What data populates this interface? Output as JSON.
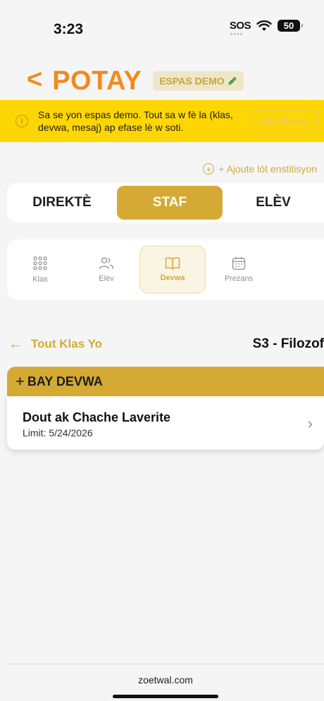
{
  "status_bar": {
    "time": "3:23",
    "sos": "SOS",
    "battery": "50"
  },
  "header": {
    "back_label": "<",
    "brand": "POTAY",
    "demo_badge": "ESPAS DEMO"
  },
  "banner": {
    "message": "Sa se yon espas demo. Tout sa w fè la (klas, devwa, mesaj) ap efase lè w soti.",
    "exit_label": "Kite Demo"
  },
  "add_institution": "+ Ajoute lòt enstitisyon",
  "role_tabs": [
    {
      "label": "DIREKTÈ"
    },
    {
      "label": "STAF",
      "active": true
    },
    {
      "label": "ELÈV"
    }
  ],
  "features": [
    {
      "label": "Klas",
      "icon": "grid-icon"
    },
    {
      "label": "Elèv",
      "icon": "users-icon"
    },
    {
      "label": "Devwa",
      "icon": "book-icon",
      "active": true
    },
    {
      "label": "Prezans",
      "icon": "calendar-icon"
    }
  ],
  "breadcrumb": {
    "back_label": "Tout Klas Yo",
    "class_title": "S3 - Filozof"
  },
  "assign_button": "BAY DEVWA",
  "assignment": {
    "title": "Dout ak Chache Laverite",
    "due": "Limit: 5/24/2026"
  },
  "footer": {
    "url": "zoetwal.com"
  },
  "colors": {
    "brand_orange": "#f28a1b",
    "gold": "#d4aa35",
    "banner_yellow": "#fed603"
  }
}
